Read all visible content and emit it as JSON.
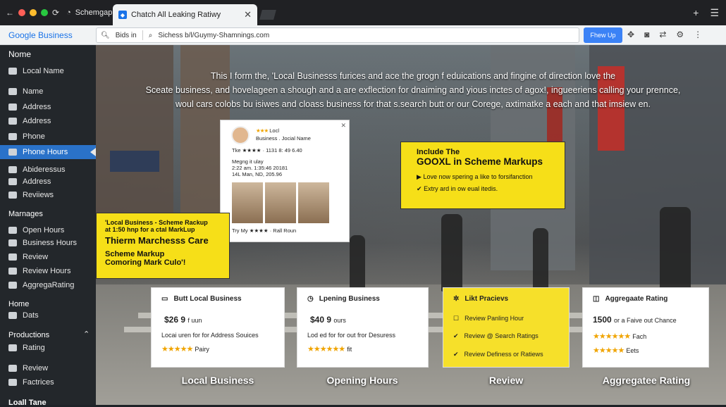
{
  "browser": {
    "inactive_tab": "Schemgapprs",
    "active_tab": "Chatch All Leaking Ratiwy",
    "logo": "Google Business",
    "url_left": "Bids in",
    "url": "Sichess b/l/Guymy-Shamnings.com",
    "show_button": "Fhew Up"
  },
  "sidebar": {
    "title": "Nome",
    "items": [
      {
        "label": "Local Name"
      },
      {
        "label": "Name"
      },
      {
        "label": "Address"
      },
      {
        "label": "Address"
      },
      {
        "label": "Phone"
      },
      {
        "label": "Phone Hours"
      },
      {
        "label": "Abideressus"
      },
      {
        "label": "Address"
      },
      {
        "label": "Reviiews"
      }
    ],
    "group2": "Marnages",
    "items2": [
      {
        "label": "Open Hours"
      },
      {
        "label": "Business Hours"
      },
      {
        "label": "Review"
      },
      {
        "label": "Review Hours"
      },
      {
        "label": "AggregaRating"
      }
    ],
    "group3": "Home",
    "items3": [
      {
        "label": "Dats"
      }
    ],
    "group4": "Productions",
    "items4": [
      {
        "label": "Rating"
      },
      {
        "label": "Review"
      },
      {
        "label": "Factrices"
      }
    ],
    "bottom": "Loall Tane"
  },
  "hero": {
    "line1": "This I form the, 'Local Businesss furices and ace the grogn f eduications and fingine of direction love the",
    "line2": "Sceate business, and hovelageen a shough and a are exflection for dnaiming and yious inctes of agox!, ingueeriens calling your prennce,",
    "line3": "woul cars colobs bu isiwes and cloass business for that s.search butt or our Corege, axtimatke a each and that imsiew en."
  },
  "listing": {
    "name": "Locl",
    "sub": "Business . Jocial Name",
    "rating_text": "Tke ★★★★ · 1131 8: 49 6.40",
    "info1": "Megng it ulay",
    "info2": "2:22 am. 1:35:46 20181",
    "info3": "14L Man, ND, 205.96",
    "footer": "Try My ★★★★ · Rall Roun"
  },
  "callout_left": {
    "line1": "'Local Business - Scheme Rackup",
    "line2": "at 1:50 hnp for a ctal MarkLup",
    "title": "Thierm Marchesss Care",
    "line3": "Scheme Markup",
    "line4": "Comoring Mark Culo'!"
  },
  "callout_right": {
    "line1": "Include The",
    "title": "GOOXL in Scheme Markups",
    "b1": "Love now spering a like to forsifanction",
    "b2": "Extry ard in ow eual itedis."
  },
  "cards": [
    {
      "title": "Butt Local Business",
      "price": "$26 9",
      "price_sub": "f uun",
      "desc": "Locai uren for for Address Souices",
      "rating": "Pairy",
      "caption": "Local Business"
    },
    {
      "title": "Lpening Business",
      "price": "$40 9",
      "price_sub": "ours",
      "desc": "Lod ed for for out fror Desuress",
      "rating": "fit",
      "caption": "Opening Hours"
    },
    {
      "title": "Likt Pracievs",
      "c1": "Review Panling Hour",
      "c2": "Review @ Search Ratings",
      "c3": "Review Definess or Ratiews",
      "caption": "Review"
    },
    {
      "title": "Aggregaate Rating",
      "price": "1500",
      "price_sub": "or a Faive out Chance",
      "r1": "Fach",
      "r2": "Eets",
      "caption": "Aggregatee Rating"
    }
  ],
  "colors": {
    "accent": "#2a72c9",
    "callout": "#f6df18",
    "star": "#f0a400"
  }
}
